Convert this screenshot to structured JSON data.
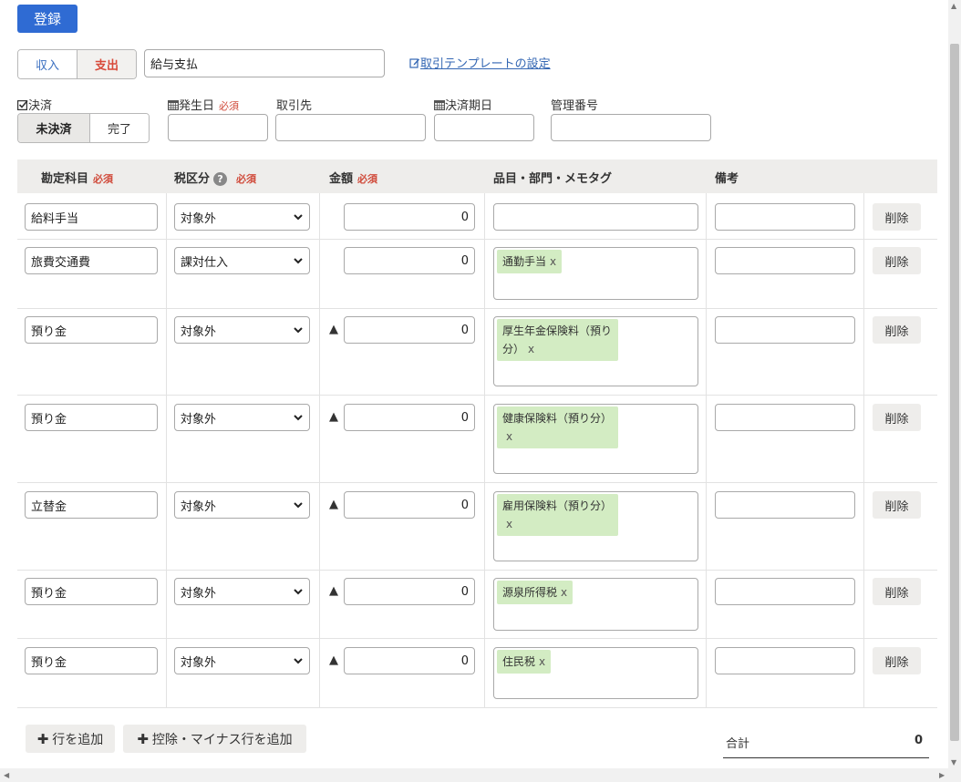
{
  "register_label": "登録",
  "type_toggle": {
    "income": "収入",
    "expense": "支出"
  },
  "summary_value": "給与支払",
  "template_link": "取引テンプレートの設定",
  "labels": {
    "settlement": "決済",
    "issue_date": "発生日",
    "partner": "取引先",
    "due_date": "決済期日",
    "mgmt_no": "管理番号",
    "required": "必須"
  },
  "settlement_toggle": {
    "unsettled": "未決済",
    "done": "完了"
  },
  "columns": {
    "account": "勘定科目",
    "tax": "税区分",
    "amount": "金額",
    "tags": "品目・部門・メモタグ",
    "note": "備考"
  },
  "rows": [
    {
      "account": "給料手当",
      "tax": "対象外",
      "minus": "",
      "amount": "0",
      "tag": "",
      "delete": "削除"
    },
    {
      "account": "旅費交通費",
      "tax": "課対仕入",
      "minus": "",
      "amount": "0",
      "tag": "通勤手当",
      "delete": "削除"
    },
    {
      "account": "預り金",
      "tax": "対象外",
      "minus": "▲",
      "amount": "0",
      "tag": "厚生年金保険料（預り分）",
      "delete": "削除"
    },
    {
      "account": "預り金",
      "tax": "対象外",
      "minus": "▲",
      "amount": "0",
      "tag": "健康保険料（預り分）",
      "delete": "削除"
    },
    {
      "account": "立替金",
      "tax": "対象外",
      "minus": "▲",
      "amount": "0",
      "tag": "雇用保険料（預り分）",
      "delete": "削除"
    },
    {
      "account": "預り金",
      "tax": "対象外",
      "minus": "▲",
      "amount": "0",
      "tag": "源泉所得税",
      "delete": "削除"
    },
    {
      "account": "預り金",
      "tax": "対象外",
      "minus": "▲",
      "amount": "0",
      "tag": "住民税",
      "delete": "削除"
    }
  ],
  "tag_remove": "x",
  "add_row_label": "行を追加",
  "add_deduction_label": "控除・マイナス行を追加",
  "total_label": "合計",
  "total_value": "0",
  "colors": {
    "primary": "#2f6bd3",
    "required": "#d04a3a",
    "tag_bg": "#d3ecc3"
  },
  "icons": {
    "check": "check-square-icon",
    "calendar": "calendar-icon",
    "edit": "edit-icon",
    "help": "help-circle-icon",
    "plus": "plus-icon",
    "select": "chevron-down-icon"
  }
}
